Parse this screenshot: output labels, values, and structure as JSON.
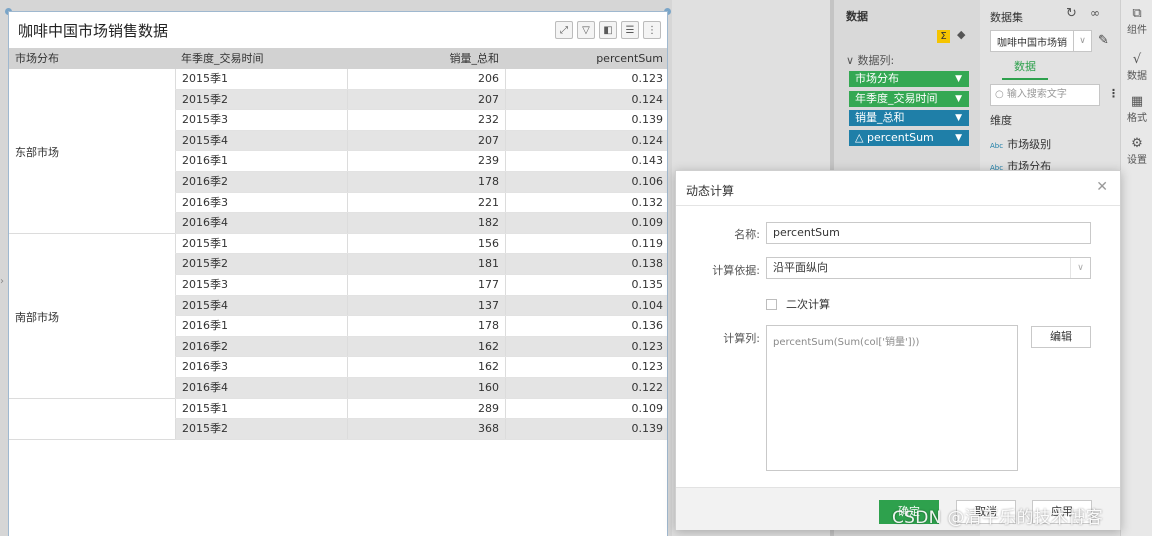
{
  "widget": {
    "title": "咖啡中国市场销售数据",
    "columns": [
      "市场分布",
      "年季度_交易时间",
      "销量_总和",
      "percentSum"
    ],
    "groups": [
      {
        "name": "东部市场",
        "rows": 8
      },
      {
        "name": "南部市场",
        "rows": 8
      },
      {
        "name": "",
        "rows": 2
      }
    ],
    "rows": [
      {
        "period": "2015季1",
        "sales": "206",
        "pct": "0.123"
      },
      {
        "period": "2015季2",
        "sales": "207",
        "pct": "0.124"
      },
      {
        "period": "2015季3",
        "sales": "232",
        "pct": "0.139"
      },
      {
        "period": "2015季4",
        "sales": "207",
        "pct": "0.124"
      },
      {
        "period": "2016季1",
        "sales": "239",
        "pct": "0.143"
      },
      {
        "period": "2016季2",
        "sales": "178",
        "pct": "0.106"
      },
      {
        "period": "2016季3",
        "sales": "221",
        "pct": "0.132"
      },
      {
        "period": "2016季4",
        "sales": "182",
        "pct": "0.109"
      },
      {
        "period": "2015季1",
        "sales": "156",
        "pct": "0.119"
      },
      {
        "period": "2015季2",
        "sales": "181",
        "pct": "0.138"
      },
      {
        "period": "2015季3",
        "sales": "177",
        "pct": "0.135"
      },
      {
        "period": "2015季4",
        "sales": "137",
        "pct": "0.104"
      },
      {
        "period": "2016季1",
        "sales": "178",
        "pct": "0.136"
      },
      {
        "period": "2016季2",
        "sales": "162",
        "pct": "0.123"
      },
      {
        "period": "2016季3",
        "sales": "162",
        "pct": "0.123"
      },
      {
        "period": "2016季4",
        "sales": "160",
        "pct": "0.122"
      },
      {
        "period": "2015季1",
        "sales": "289",
        "pct": "0.109"
      },
      {
        "period": "2015季2",
        "sales": "368",
        "pct": "0.139"
      }
    ]
  },
  "data_panel": {
    "title": "数据",
    "sigma": "Σ",
    "columns_label": "∨ 数据列:",
    "fields": [
      {
        "label": "市场分布",
        "kind": "dimension"
      },
      {
        "label": "年季度_交易时间",
        "kind": "dimension"
      },
      {
        "label": "销量_总和",
        "kind": "measure"
      },
      {
        "label": "△ percentSum",
        "kind": "measure"
      }
    ]
  },
  "dataset_panel": {
    "title": "数据集",
    "dataset_name": "咖啡中国市场销",
    "tab_label": "数据",
    "search_placeholder": "输入搜索文字",
    "dimension_label": "维度",
    "fields": [
      "市场级别",
      "市场分布"
    ],
    "abc": "Abc"
  },
  "rail": [
    {
      "label": "组件",
      "icon": "widget-icon"
    },
    {
      "label": "数据",
      "icon": "data-icon"
    },
    {
      "label": "格式",
      "icon": "format-icon"
    },
    {
      "label": "设置",
      "icon": "settings-icon"
    }
  ],
  "dialog": {
    "title": "动态计算",
    "name_label": "名称:",
    "name_value": "percentSum",
    "basis_label": "计算依据:",
    "basis_value": "沿平面纵向",
    "secondary_label": "二次计算",
    "formula_label": "计算列:",
    "formula_value": "percentSum(Sum(col['销量']))",
    "edit_label": "编辑",
    "ok_label": "确定",
    "cancel_label": "取消",
    "apply_label": "应用"
  },
  "watermark": "CSDN @清平乐的技术博客",
  "colors": {
    "green": "#34a853",
    "blue": "#1f7fa8",
    "accent_green": "#2ea14d"
  }
}
